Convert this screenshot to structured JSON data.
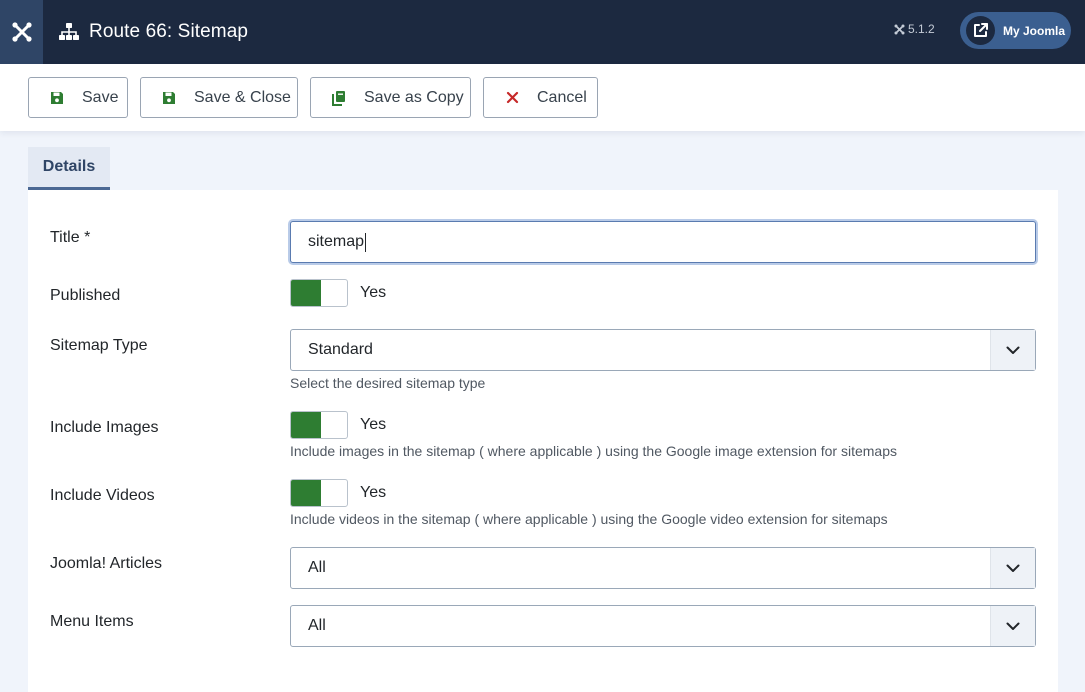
{
  "header": {
    "title": "Route 66: Sitemap",
    "version": "5.1.2",
    "my_joomla_label": "My Joomla",
    "icons": {
      "logo": "joomla-logo-icon",
      "title": "sitemap-icon",
      "version": "joomla-small-icon",
      "external": "external-link-icon"
    }
  },
  "toolbar": {
    "save_label": "Save",
    "save_close_label": "Save & Close",
    "save_copy_label": "Save as Copy",
    "cancel_label": "Cancel",
    "icons": {
      "save": "floppy-icon",
      "save_close": "floppy-icon",
      "save_copy": "copy-icon",
      "cancel": "close-icon"
    },
    "colors": {
      "save_icon": "#2e7d32",
      "cancel_icon": "#c62828"
    }
  },
  "tabs": [
    {
      "label": "Details",
      "active": true
    }
  ],
  "form": {
    "title": {
      "label": "Title *",
      "value": "sitemap"
    },
    "published": {
      "label": "Published",
      "state": "Yes"
    },
    "sitemap_type": {
      "label": "Sitemap Type",
      "value": "Standard",
      "hint": "Select the desired sitemap type"
    },
    "include_images": {
      "label": "Include Images",
      "state": "Yes",
      "hint": "Include images in the sitemap ( where applicable ) using the Google image extension for sitemaps"
    },
    "include_videos": {
      "label": "Include Videos",
      "state": "Yes",
      "hint": "Include videos in the sitemap ( where applicable ) using the Google video extension for sitemaps"
    },
    "joomla_articles": {
      "label": "Joomla! Articles",
      "value": "All"
    },
    "menu_items": {
      "label": "Menu Items",
      "value": "All"
    }
  },
  "colors": {
    "header_bg": "#1c2940",
    "toggle_on": "#2e7d32",
    "accent": "#4b6893"
  }
}
